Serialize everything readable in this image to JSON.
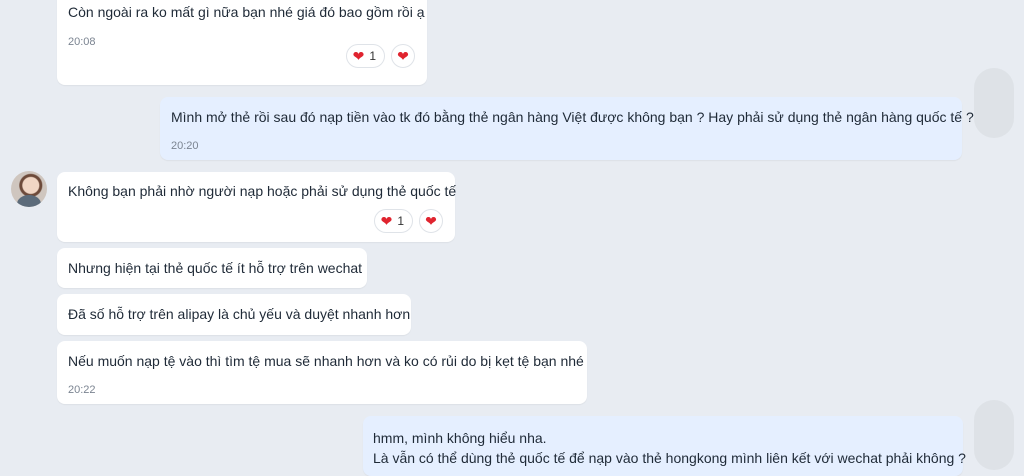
{
  "messages": [
    {
      "text": "Còn ngoài ra ko mất gì nữa bạn nhé giá đó bao gồm rồi ạ",
      "time": "20:08",
      "reaction_count": "1"
    },
    {
      "text": "Mình mở thẻ rồi sau đó nạp tiền vào tk đó bằng thẻ ngân hàng Việt được không bạn ? Hay phải sử dụng thẻ ngân hàng quốc tế ?",
      "time": "20:20"
    },
    {
      "text": "Không bạn phải nhờ người nạp hoặc phải sử dụng thẻ quốc tế",
      "reaction_count": "1"
    },
    {
      "text": "Nhưng hiện tại thẻ quốc tế ít hỗ trợ trên wechat"
    },
    {
      "text": "Đã số hỗ trợ trên alipay là chủ yếu và duyệt nhanh hơn"
    },
    {
      "text": "Nếu muốn nạp tệ vào thì tìm tệ mua sẽ nhanh hơn và ko có rủi do bị kẹt tệ  bạn nhé",
      "time": "20:22"
    },
    {
      "line1": "hmm, mình không hiểu nha.",
      "line2": "Là vẫn có thể dùng thẻ quốc tế để nạp vào thẻ hongkong mình liên kết với wechat phải không ?"
    }
  ],
  "colors": {
    "background": "#e8ecf2",
    "incoming": "#ffffff",
    "outgoing": "#e5efff",
    "heart": "#e0242f"
  },
  "icons": {
    "reaction": "heart-icon"
  }
}
